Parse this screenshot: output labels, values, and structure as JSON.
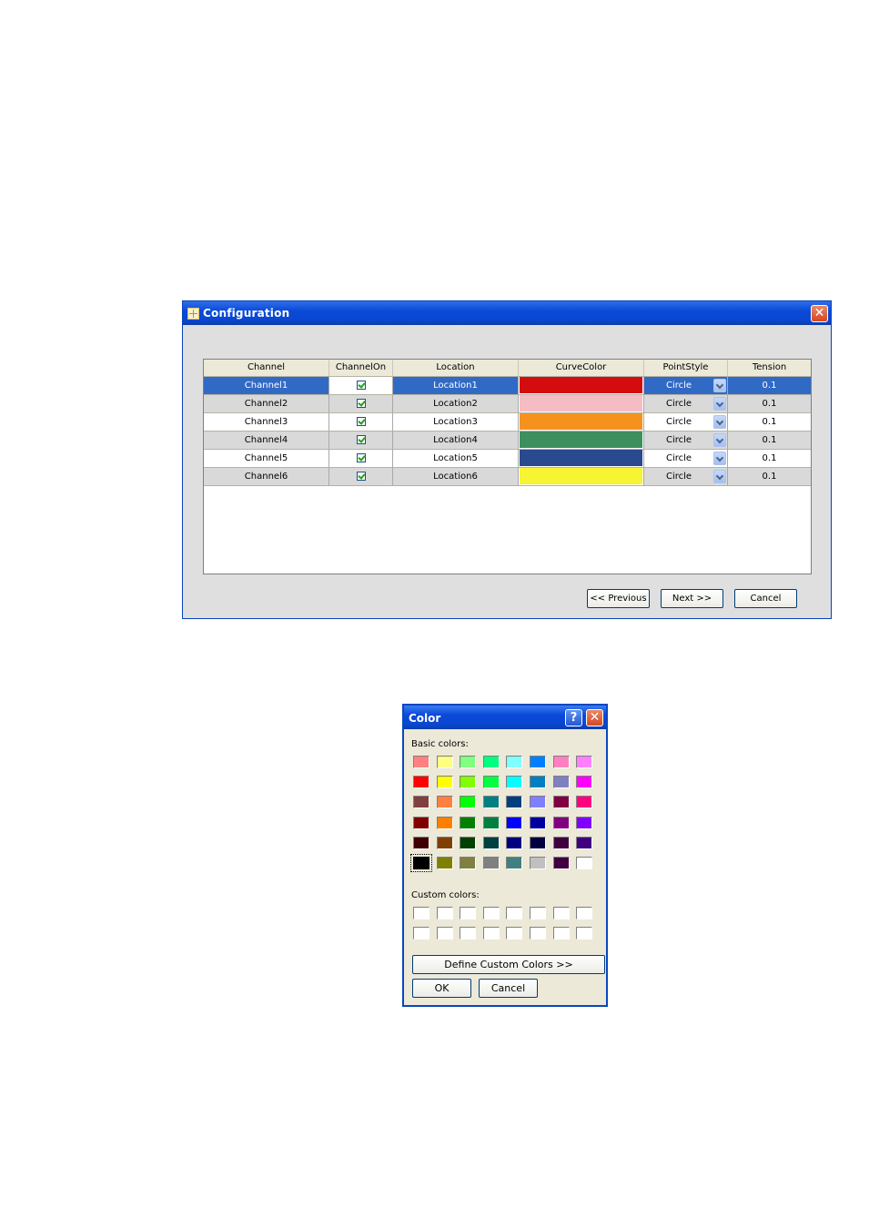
{
  "config_window": {
    "title": "Configuration",
    "columns": [
      "Channel",
      "ChannelOn",
      "Location",
      "CurveColor",
      "PointStyle",
      "Tension"
    ],
    "rows": [
      {
        "channel": "Channel1",
        "on": true,
        "location": "Location1",
        "color": "#d40c10",
        "point_style": "Circle",
        "tension": "0.1",
        "selected": true
      },
      {
        "channel": "Channel2",
        "on": true,
        "location": "Location2",
        "color": "#f5bcc3",
        "point_style": "Circle",
        "tension": "0.1"
      },
      {
        "channel": "Channel3",
        "on": true,
        "location": "Location3",
        "color": "#f5921e",
        "point_style": "Circle",
        "tension": "0.1"
      },
      {
        "channel": "Channel4",
        "on": true,
        "location": "Location4",
        "color": "#3e8f5e",
        "point_style": "Circle",
        "tension": "0.1"
      },
      {
        "channel": "Channel5",
        "on": true,
        "location": "Location5",
        "color": "#2a4a8f",
        "point_style": "Circle",
        "tension": "0.1"
      },
      {
        "channel": "Channel6",
        "on": true,
        "location": "Location6",
        "color": "#f7f432",
        "point_style": "Circle",
        "tension": "0.1"
      }
    ],
    "buttons": {
      "previous": "<< Previous",
      "next": "Next >>",
      "cancel": "Cancel"
    }
  },
  "color_dialog": {
    "title": "Color",
    "help_glyph": "?",
    "close_glyph": "✕",
    "basic_label": "Basic colors:",
    "basic_colors": [
      [
        "#ff8080",
        "#ffff80",
        "#80ff80",
        "#00ff80",
        "#80ffff",
        "#0080ff",
        "#ff80c0",
        "#ff80ff"
      ],
      [
        "#ff0000",
        "#ffff00",
        "#80ff00",
        "#00ff40",
        "#00ffff",
        "#0080c0",
        "#8080c0",
        "#ff00ff"
      ],
      [
        "#804040",
        "#ff8040",
        "#00ff00",
        "#008080",
        "#004080",
        "#8080ff",
        "#800040",
        "#ff0080"
      ],
      [
        "#800000",
        "#ff8000",
        "#008000",
        "#008040",
        "#0000ff",
        "#0000a0",
        "#800080",
        "#8000ff"
      ],
      [
        "#400000",
        "#804000",
        "#004000",
        "#004040",
        "#000080",
        "#000040",
        "#400040",
        "#400080"
      ],
      [
        "#000000",
        "#808000",
        "#808040",
        "#808080",
        "#408080",
        "#c0c0c0",
        "#400040",
        "#ffffff"
      ]
    ],
    "custom_label": "Custom colors:",
    "custom_colors": [
      [
        "#ffffff",
        "#ffffff",
        "#ffffff",
        "#ffffff",
        "#ffffff",
        "#ffffff",
        "#ffffff",
        "#ffffff"
      ],
      [
        "#ffffff",
        "#ffffff",
        "#ffffff",
        "#ffffff",
        "#ffffff",
        "#ffffff",
        "#ffffff",
        "#ffffff"
      ]
    ],
    "selected_basic": "black",
    "define_button": "Define Custom Colors >>",
    "ok_button": "OK",
    "cancel_button": "Cancel"
  }
}
